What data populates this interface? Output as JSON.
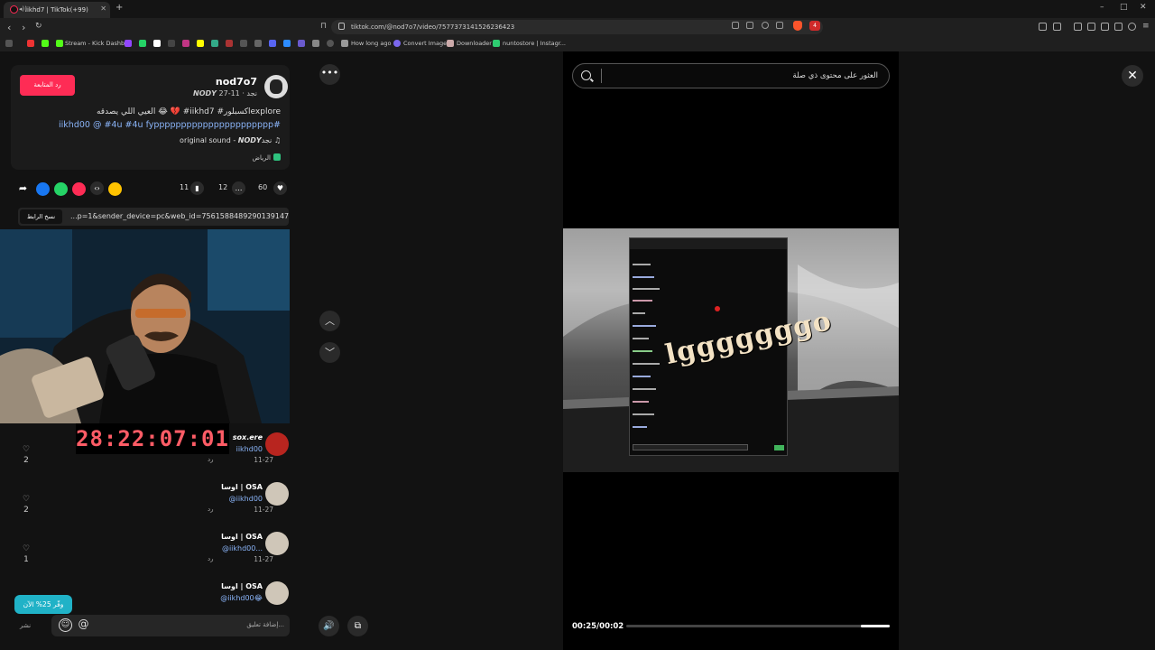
{
  "browser": {
    "tab_title": "iikhd7 | TikTok⁦(+99)⁩",
    "url": "tiktok.com/@nod7o7/video/7577373141526236423",
    "brave_badge": "4",
    "bookmarks": [
      "Stream - Kick Dashb...",
      "How long ago",
      "Convert Image",
      "Downloader",
      "nuntostore | Instagr..."
    ]
  },
  "post": {
    "follow_label": "رد المتابعة",
    "username": "nod7o7",
    "nick_date": "𝙉𝙊𝘿𝙔 نجد · 11-27",
    "caption_line1": "العيي اللي يصدقه 😂 💔 #iikhd7 #اكسبلورexplore",
    "caption_line2": "iikhd00 @ #4u #4u fypppppppppppppppppppppp#",
    "music": "original sound - 𝙉𝙊𝘿𝙔نجد",
    "location": "الرياض",
    "likes": "60",
    "comments": "12",
    "saves": "11",
    "copy_link_label": "نسخ الرابط",
    "link_text": "...p=1&sender_device=pc&web_id=7561588489290139147"
  },
  "stream_timer": "28:22:07:01",
  "comments": [
    {
      "name": "𝙨𝙤𝙭.𝙚𝙧𝙚",
      "text": "iikhd00",
      "date": "11-27",
      "likes": "2",
      "reply": "رد"
    },
    {
      "name": "اوسا | OSA",
      "text": "@iikhd00",
      "date": "11-27",
      "likes": "2",
      "reply": "رد"
    },
    {
      "name": "اوسا | OSA",
      "text": "@iikhd00...",
      "date": "11-27",
      "likes": "1",
      "reply": "رد"
    },
    {
      "name": "اوسا | OSA",
      "text": "@iikhd00😂",
      "date": "",
      "likes": "",
      "reply": ""
    }
  ],
  "promo_label": "وفّر 25% الآن",
  "post_button": "نشر",
  "comment_placeholder": "إضافة تعليق...",
  "video": {
    "search_placeholder": "العثور على محتوى ذي صلة",
    "overlay_text": "lgggggggo",
    "time_readout": "00:25/00:02",
    "progress_fraction": 0.11
  }
}
